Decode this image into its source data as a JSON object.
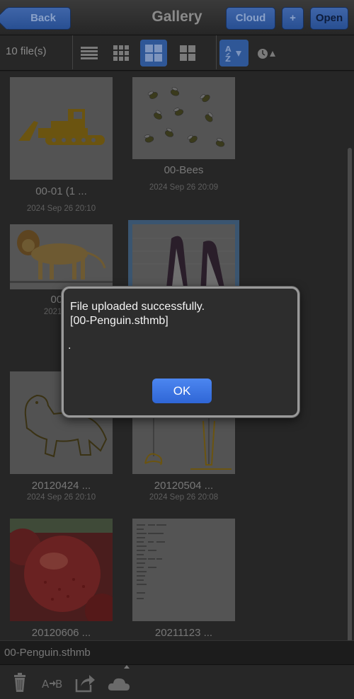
{
  "header": {
    "back_label": "Back",
    "title": "Gallery",
    "cloud_label": "Cloud",
    "plus_label": "+",
    "open_label": "Open"
  },
  "toolbar": {
    "file_count": "10 file(s)",
    "view_modes": [
      "list-icon",
      "small-grid-icon",
      "medium-grid-icon",
      "large-grid-icon"
    ],
    "active_view_mode": "medium-grid-icon",
    "sort_buttons": [
      "sort-az-icon",
      "sort-time-icon"
    ]
  },
  "gallery": {
    "items": [
      {
        "name": "00-01 (1 ...",
        "date": "2024 Sep 26 20:10"
      },
      {
        "name": "00-Bees",
        "date": "2024 Sep 26 20:09"
      },
      {
        "name": "00-L",
        "date": "2021 Nov"
      },
      {
        "name": "",
        "date": ""
      },
      {
        "name": "20120424 ...",
        "date": "2024 Sep 26 20:10"
      },
      {
        "name": "20120504 ...",
        "date": "2024 Sep 26 20:08"
      },
      {
        "name": "20120606 ...",
        "date": ""
      },
      {
        "name": "20211123 ...",
        "date": ""
      }
    ],
    "selected_index": 3
  },
  "status": {
    "filename": "00-Penguin.sthmb"
  },
  "bottom_bar": {
    "icons": [
      "trash-icon",
      "rename-icon",
      "share-icon",
      "cloud-upload-icon"
    ]
  },
  "dialog": {
    "line1": "File uploaded successfully.",
    "line2": "[00-Penguin.sthmb]",
    "line3": ".",
    "ok_label": "OK"
  },
  "colors": {
    "accent_blue": "#2f5797",
    "ok_button": "#3d78e6",
    "background": "#262626"
  }
}
